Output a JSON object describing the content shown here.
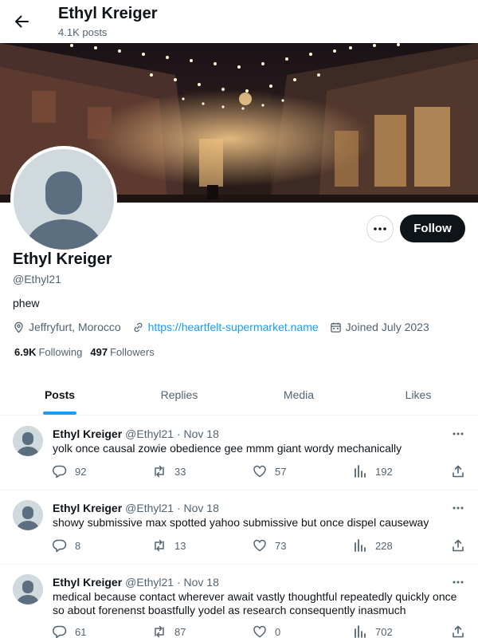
{
  "header": {
    "title": "Ethyl Kreiger",
    "post_count": "4.1K posts"
  },
  "profile": {
    "name": "Ethyl Kreiger",
    "handle": "@Ethyl21",
    "bio": "phew",
    "location": "Jeffryfurt, Morocco",
    "website": "https://heartfelt-supermarket.name",
    "joined": "Joined July 2023",
    "following_count": "6.9K",
    "following_label": "Following",
    "followers_count": "497",
    "followers_label": "Followers",
    "follow_label": "Follow"
  },
  "tabs": [
    {
      "label": "Posts",
      "active": true
    },
    {
      "label": "Replies",
      "active": false
    },
    {
      "label": "Media",
      "active": false
    },
    {
      "label": "Likes",
      "active": false
    }
  ],
  "posts": [
    {
      "author": "Ethyl Kreiger",
      "meta": "@Ethyl21 · Nov 18",
      "text": "yolk once causal zowie obedience gee mmm giant wordy mechanically",
      "replies": "92",
      "reposts": "33",
      "likes": "57",
      "views": "192"
    },
    {
      "author": "Ethyl Kreiger",
      "meta": "@Ethyl21 · Nov 18",
      "text": "showy submissive max spotted yahoo submissive but once dispel causeway",
      "replies": "8",
      "reposts": "13",
      "likes": "73",
      "views": "228"
    },
    {
      "author": "Ethyl Kreiger",
      "meta": "@Ethyl21 · Nov 18",
      "text": "medical because contact wherever await vastly thoughtful repeatedly quickly once so about forenenst boastfully yodel as research consequently inasmuch",
      "replies": "61",
      "reposts": "87",
      "likes": "0",
      "views": "702"
    }
  ],
  "colors": {
    "accent": "#1d9bf0",
    "text": "#0f1419",
    "muted": "#536471",
    "border": "#eff3f4"
  }
}
